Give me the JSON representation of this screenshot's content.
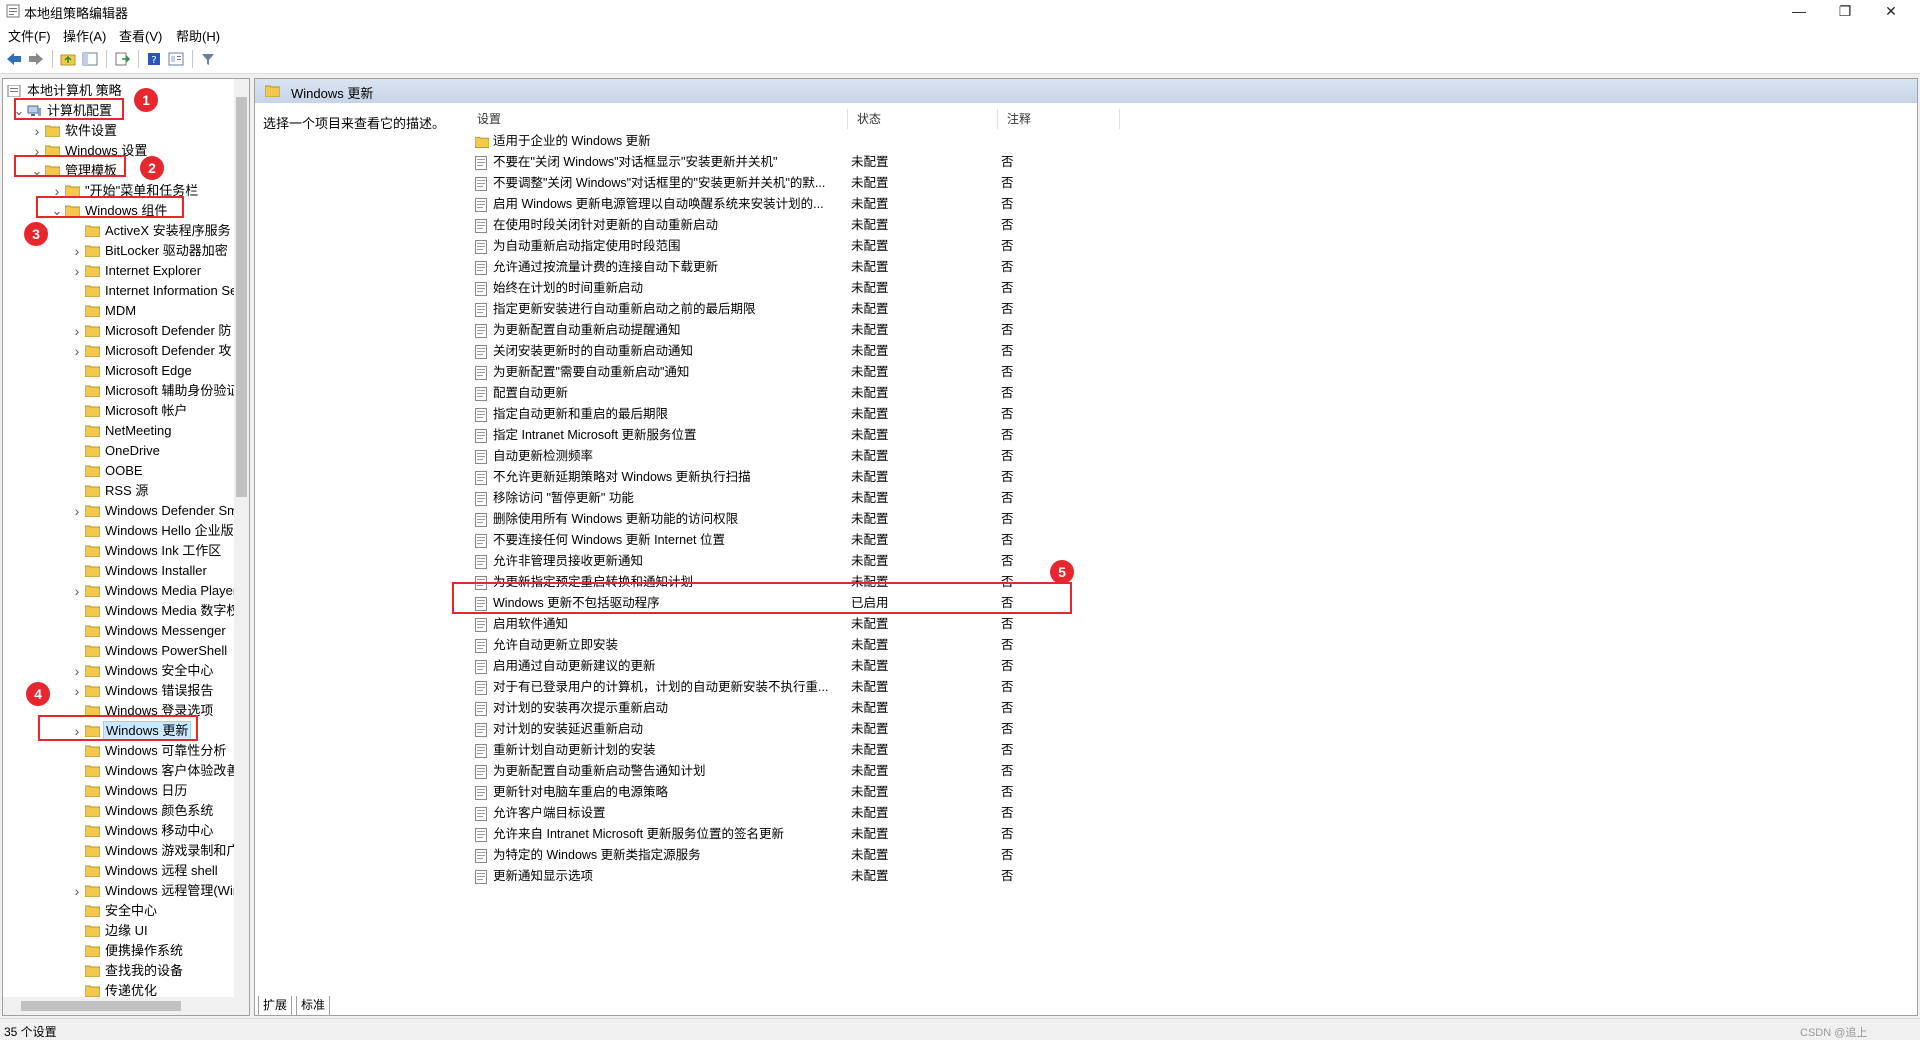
{
  "window": {
    "title": "本地组策略编辑器",
    "min": "—",
    "max": "❐",
    "close": "✕"
  },
  "menu": [
    "文件(F)",
    "操作(A)",
    "查看(V)",
    "帮助(H)"
  ],
  "tree": {
    "root": "本地计算机 策略",
    "items": [
      {
        "label": "计算机配置",
        "level": 0,
        "expand": "open"
      },
      {
        "label": "软件设置",
        "level": 1,
        "expand": "closed"
      },
      {
        "label": "Windows 设置",
        "level": 1,
        "expand": "closed"
      },
      {
        "label": "管理模板",
        "level": 1,
        "expand": "open"
      },
      {
        "label": "\"开始\"菜单和任务栏",
        "level": 2,
        "expand": "closed"
      },
      {
        "label": "Windows 组件",
        "level": 2,
        "expand": "open"
      },
      {
        "label": "ActiveX 安装程序服务",
        "level": 3,
        "expand": "none"
      },
      {
        "label": "BitLocker 驱动器加密",
        "level": 3,
        "expand": "closed"
      },
      {
        "label": "Internet Explorer",
        "level": 3,
        "expand": "closed"
      },
      {
        "label": "Internet Information Se",
        "level": 3,
        "expand": "none"
      },
      {
        "label": "MDM",
        "level": 3,
        "expand": "none"
      },
      {
        "label": "Microsoft Defender 防",
        "level": 3,
        "expand": "closed"
      },
      {
        "label": "Microsoft Defender 攻",
        "level": 3,
        "expand": "closed"
      },
      {
        "label": "Microsoft Edge",
        "level": 3,
        "expand": "none"
      },
      {
        "label": "Microsoft 辅助身份验证",
        "level": 3,
        "expand": "none"
      },
      {
        "label": "Microsoft 帐户",
        "level": 3,
        "expand": "none"
      },
      {
        "label": "NetMeeting",
        "level": 3,
        "expand": "none"
      },
      {
        "label": "OneDrive",
        "level": 3,
        "expand": "none"
      },
      {
        "label": "OOBE",
        "level": 3,
        "expand": "none"
      },
      {
        "label": "RSS 源",
        "level": 3,
        "expand": "none"
      },
      {
        "label": "Windows Defender Sm",
        "level": 3,
        "expand": "closed"
      },
      {
        "label": "Windows Hello 企业版",
        "level": 3,
        "expand": "none"
      },
      {
        "label": "Windows Ink 工作区",
        "level": 3,
        "expand": "none"
      },
      {
        "label": "Windows Installer",
        "level": 3,
        "expand": "none"
      },
      {
        "label": "Windows Media Player",
        "level": 3,
        "expand": "closed"
      },
      {
        "label": "Windows Media 数字权",
        "level": 3,
        "expand": "none"
      },
      {
        "label": "Windows Messenger",
        "level": 3,
        "expand": "none"
      },
      {
        "label": "Windows PowerShell",
        "level": 3,
        "expand": "none"
      },
      {
        "label": "Windows 安全中心",
        "level": 3,
        "expand": "closed"
      },
      {
        "label": "Windows 错误报告",
        "level": 3,
        "expand": "closed"
      },
      {
        "label": "Windows 登录选项",
        "level": 3,
        "expand": "none"
      },
      {
        "label": "Windows 更新",
        "level": 3,
        "expand": "closed",
        "selected": true
      },
      {
        "label": "Windows 可靠性分析",
        "level": 3,
        "expand": "none"
      },
      {
        "label": "Windows 客户体验改善",
        "level": 3,
        "expand": "none"
      },
      {
        "label": "Windows 日历",
        "level": 3,
        "expand": "none"
      },
      {
        "label": "Windows 颜色系统",
        "level": 3,
        "expand": "none"
      },
      {
        "label": "Windows 移动中心",
        "level": 3,
        "expand": "none"
      },
      {
        "label": "Windows 游戏录制和广",
        "level": 3,
        "expand": "none"
      },
      {
        "label": "Windows 远程 shell",
        "level": 3,
        "expand": "none"
      },
      {
        "label": "Windows 远程管理(Win",
        "level": 3,
        "expand": "closed"
      },
      {
        "label": "安全中心",
        "level": 3,
        "expand": "none"
      },
      {
        "label": "边缘 UI",
        "level": 3,
        "expand": "none"
      },
      {
        "label": "便携操作系统",
        "level": 3,
        "expand": "none"
      },
      {
        "label": "查找我的设备",
        "level": 3,
        "expand": "none"
      },
      {
        "label": "传递优化",
        "level": 3,
        "expand": "none"
      }
    ]
  },
  "right": {
    "header": "Windows 更新",
    "description": "选择一个项目来查看它的描述。",
    "columns": {
      "setting": "设置",
      "state": "状态",
      "comment": "注释"
    },
    "folder_row": "适用于企业的 Windows 更新",
    "rows": [
      {
        "name": "不要在\"关闭 Windows\"对话框显示\"安装更新并关机\"",
        "state": "未配置",
        "note": "否"
      },
      {
        "name": "不要调整\"关闭 Windows\"对话框里的\"安装更新并关机\"的默...",
        "state": "未配置",
        "note": "否"
      },
      {
        "name": "启用 Windows 更新电源管理以自动唤醒系统来安装计划的...",
        "state": "未配置",
        "note": "否"
      },
      {
        "name": "在使用时段关闭针对更新的自动重新启动",
        "state": "未配置",
        "note": "否"
      },
      {
        "name": "为自动重新启动指定使用时段范围",
        "state": "未配置",
        "note": "否"
      },
      {
        "name": "允许通过按流量计费的连接自动下载更新",
        "state": "未配置",
        "note": "否"
      },
      {
        "name": "始终在计划的时间重新启动",
        "state": "未配置",
        "note": "否"
      },
      {
        "name": "指定更新安装进行自动重新启动之前的最后期限",
        "state": "未配置",
        "note": "否"
      },
      {
        "name": "为更新配置自动重新启动提醒通知",
        "state": "未配置",
        "note": "否"
      },
      {
        "name": "关闭安装更新时的自动重新启动通知",
        "state": "未配置",
        "note": "否"
      },
      {
        "name": "为更新配置\"需要自动重新启动\"通知",
        "state": "未配置",
        "note": "否"
      },
      {
        "name": "配置自动更新",
        "state": "未配置",
        "note": "否"
      },
      {
        "name": "指定自动更新和重启的最后期限",
        "state": "未配置",
        "note": "否"
      },
      {
        "name": "指定 Intranet Microsoft 更新服务位置",
        "state": "未配置",
        "note": "否"
      },
      {
        "name": "自动更新检测频率",
        "state": "未配置",
        "note": "否"
      },
      {
        "name": "不允许更新延期策略对 Windows 更新执行扫描",
        "state": "未配置",
        "note": "否"
      },
      {
        "name": "移除访问 \"暂停更新\" 功能",
        "state": "未配置",
        "note": "否"
      },
      {
        "name": "删除使用所有 Windows 更新功能的访问权限",
        "state": "未配置",
        "note": "否"
      },
      {
        "name": "不要连接任何 Windows 更新 Internet 位置",
        "state": "未配置",
        "note": "否"
      },
      {
        "name": "允许非管理员接收更新通知",
        "state": "未配置",
        "note": "否"
      },
      {
        "name": "为更新指定预定重启转换和通知计划",
        "state": "未配置",
        "note": "否"
      },
      {
        "name": "Windows 更新不包括驱动程序",
        "state": "已启用",
        "note": "否"
      },
      {
        "name": "启用软件通知",
        "state": "未配置",
        "note": "否"
      },
      {
        "name": "允许自动更新立即安装",
        "state": "未配置",
        "note": "否"
      },
      {
        "name": "启用通过自动更新建议的更新",
        "state": "未配置",
        "note": "否"
      },
      {
        "name": "对于有已登录用户的计算机，计划的自动更新安装不执行重...",
        "state": "未配置",
        "note": "否"
      },
      {
        "name": "对计划的安装再次提示重新启动",
        "state": "未配置",
        "note": "否"
      },
      {
        "name": "对计划的安装延迟重新启动",
        "state": "未配置",
        "note": "否"
      },
      {
        "name": "重新计划自动更新计划的安装",
        "state": "未配置",
        "note": "否"
      },
      {
        "name": "为更新配置自动重新启动警告通知计划",
        "state": "未配置",
        "note": "否"
      },
      {
        "name": "更新针对电脑车重启的电源策略",
        "state": "未配置",
        "note": "否"
      },
      {
        "name": "允许客户端目标设置",
        "state": "未配置",
        "note": "否"
      },
      {
        "name": "允许来自 Intranet Microsoft 更新服务位置的签名更新",
        "state": "未配置",
        "note": "否"
      },
      {
        "name": "为特定的 Windows 更新类指定源服务",
        "state": "未配置",
        "note": "否"
      },
      {
        "name": "更新通知显示选项",
        "state": "未配置",
        "note": "否"
      }
    ]
  },
  "tabs": [
    "扩展",
    "标准"
  ],
  "status": "35 个设置",
  "watermark": "CSDN @追上",
  "annotations": [
    "1",
    "2",
    "3",
    "4",
    "5"
  ],
  "colors": {
    "annotation": "#e8262d",
    "folder": "#f2c94c",
    "selection": "#cce8ff"
  }
}
